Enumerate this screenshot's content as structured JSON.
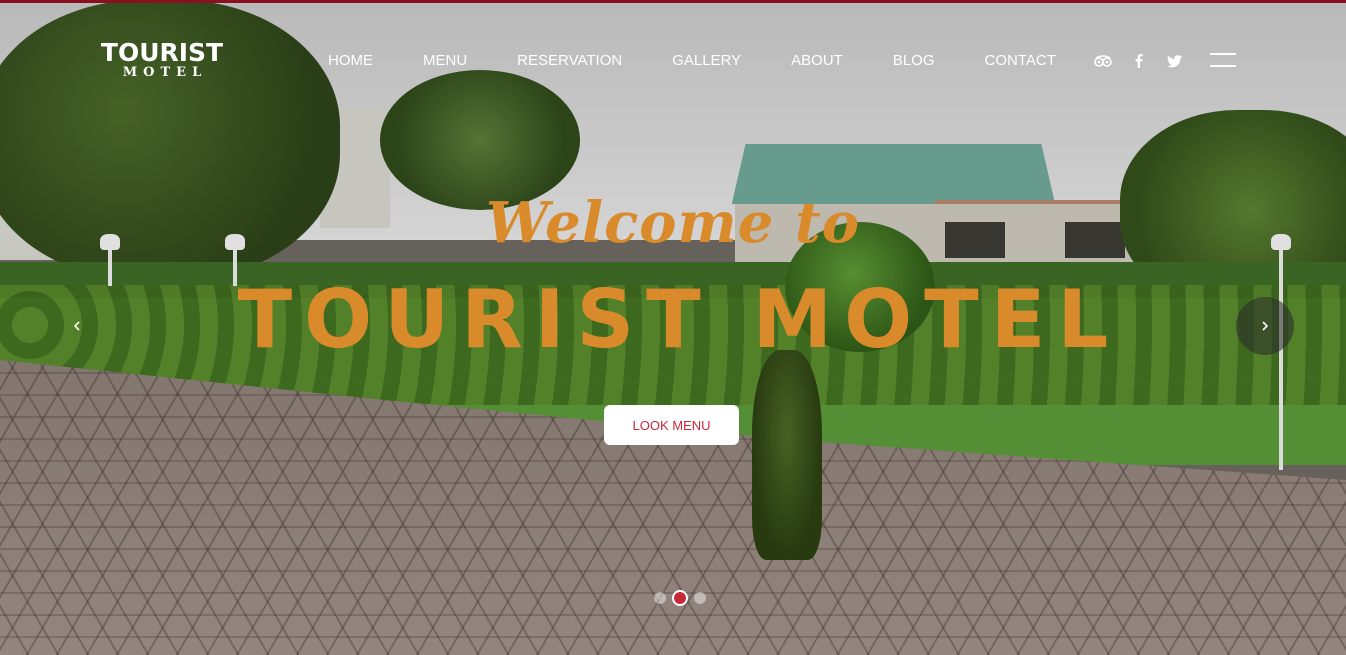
{
  "brand": {
    "name": "TOURIST",
    "sub": "MOTEL"
  },
  "nav": [
    {
      "label": "HOME"
    },
    {
      "label": "MENU"
    },
    {
      "label": "RESERVATION"
    },
    {
      "label": "GALLERY"
    },
    {
      "label": "ABOUT"
    },
    {
      "label": "BLOG"
    },
    {
      "label": "CONTACT"
    }
  ],
  "social": [
    "tripadvisor-icon",
    "facebook-icon",
    "twitter-icon"
  ],
  "hero": {
    "welcome": "Welcome to",
    "headline": "TOURIST MOTEL",
    "cta": "LOOK MENU"
  },
  "slider": {
    "slide_count": 3,
    "active_slide": 2
  },
  "colors": {
    "accent": "#d98b2b",
    "brand_red": "#c8283a",
    "top_bar": "#8a1020"
  }
}
